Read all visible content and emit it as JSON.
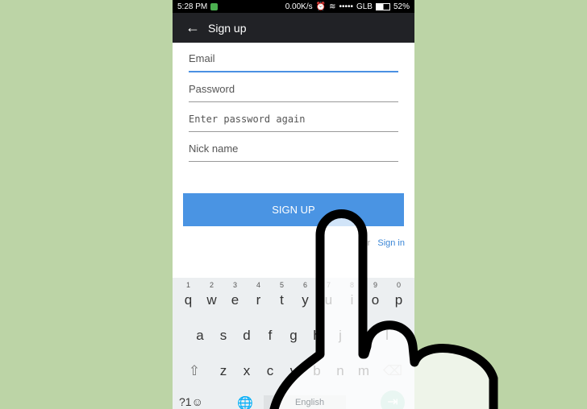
{
  "status": {
    "time": "5:28 PM",
    "speed": "0.00K/s",
    "carrier": "GLB",
    "battery": "52%"
  },
  "toolbar": {
    "title": "Sign up"
  },
  "form": {
    "email_placeholder": "Email",
    "password_placeholder": "Password",
    "confirm_placeholder": "Enter password again",
    "nick_placeholder": "Nick name",
    "signup_label": "SIGN UP",
    "or_label": "Or",
    "signin_label": "Sign in"
  },
  "keyboard": {
    "row1": [
      [
        "q",
        "1"
      ],
      [
        "w",
        "2"
      ],
      [
        "e",
        "3"
      ],
      [
        "r",
        "4"
      ],
      [
        "t",
        "5"
      ],
      [
        "y",
        "6"
      ],
      [
        "u",
        "7"
      ],
      [
        "i",
        "8"
      ],
      [
        "o",
        "9"
      ],
      [
        "p",
        "0"
      ]
    ],
    "row2": [
      "a",
      "s",
      "d",
      "f",
      "g",
      "h",
      "j",
      "k",
      "l"
    ],
    "row3": [
      "z",
      "x",
      "c",
      "v",
      "b",
      "n",
      "m"
    ],
    "symbols": "?1☺",
    "space": "English"
  },
  "colors": {
    "accent": "#4a94e3",
    "background": "#bcd4a6"
  }
}
